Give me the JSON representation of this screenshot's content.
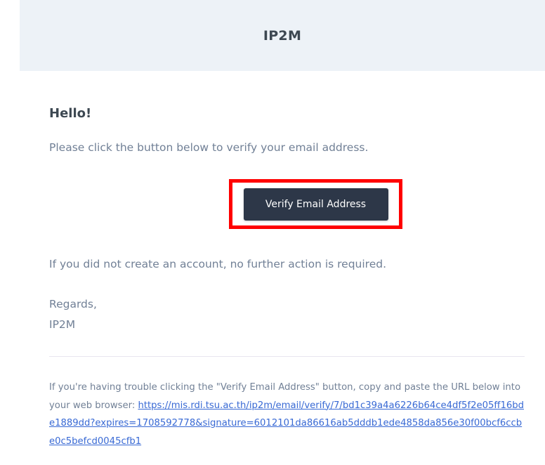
{
  "header": {
    "title": "IP2M"
  },
  "email": {
    "greeting": "Hello!",
    "intro": "Please click the button below to verify your email address.",
    "button_label": "Verify Email Address",
    "no_action": "If you did not create an account, no further action is required.",
    "regards": "Regards,",
    "signature": "IP2M",
    "subcopy_text": "If you're having trouble clicking the \"Verify Email Address\" button, copy and paste the URL below into your web browser: ",
    "verify_url": "https://mis.rdi.tsu.ac.th/ip2m/email/verify/7/bd1c39a4a6226b64ce4df5f2e05ff16bde1889dd?expires=1708592778&signature=6012101da86616ab5dddb1ede4858da856e30f00bcf6ccbe0c5befcd0045cfb1"
  },
  "colors": {
    "background": "#edf2f7",
    "card": "#ffffff",
    "heading": "#3d4852",
    "body_text": "#718096",
    "button_bg": "#2d3748",
    "link": "#3869d4",
    "highlight_border": "#ff0000"
  }
}
